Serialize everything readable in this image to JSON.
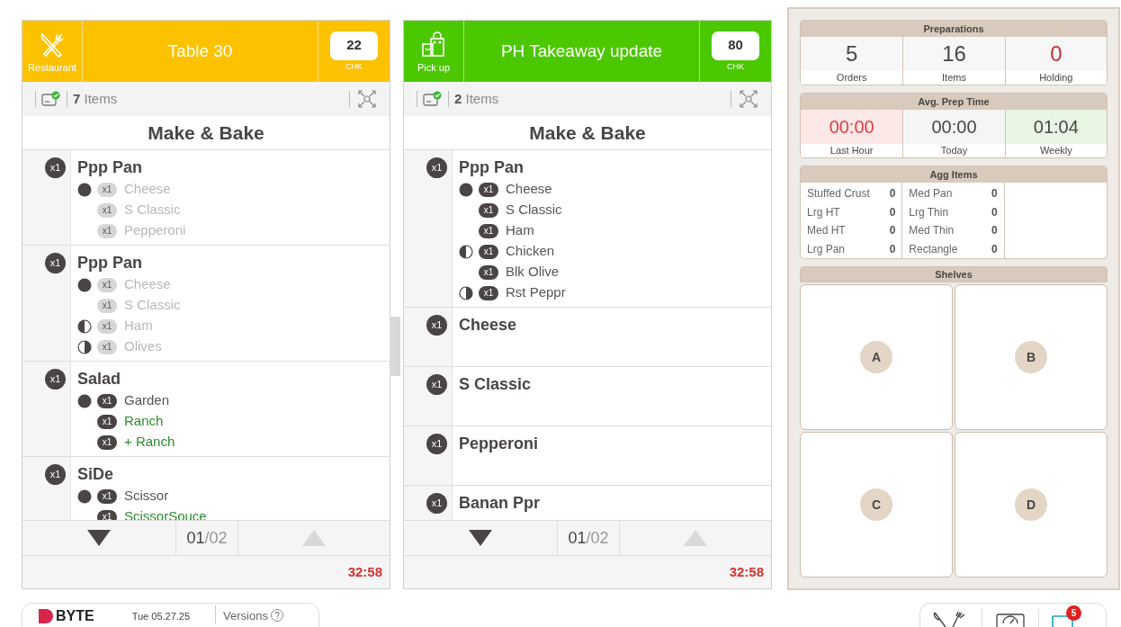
{
  "orders": [
    {
      "kind": "restaurant",
      "type_label": "Restaurant",
      "color": "#fcc200",
      "title": "Table 30",
      "check": "22",
      "check_label": "CHK",
      "item_count": "7",
      "item_label": "Items",
      "station": "Make & Bake",
      "items": [
        {
          "qty": "x1",
          "name": "Ppp Pan",
          "done": true,
          "modifiers": [
            {
              "kind": "whole",
              "qty": "x1",
              "name": "Cheese",
              "extra": false
            },
            {
              "kind": "plain",
              "qty": "x1",
              "name": "S Classic",
              "extra": false
            },
            {
              "kind": "plain",
              "qty": "x1",
              "name": "Pepperoni",
              "extra": false
            }
          ]
        },
        {
          "qty": "x1",
          "name": "Ppp Pan",
          "done": true,
          "modifiers": [
            {
              "kind": "whole",
              "qty": "x1",
              "name": "Cheese",
              "extra": false
            },
            {
              "kind": "plain",
              "qty": "x1",
              "name": "S Classic",
              "extra": false
            },
            {
              "kind": "left_half",
              "qty": "x1",
              "name": "Ham",
              "extra": false
            },
            {
              "kind": "right_half",
              "qty": "x1",
              "name": "Olives",
              "extra": false
            }
          ]
        },
        {
          "qty": "x1",
          "name": "Salad",
          "done": false,
          "modifiers": [
            {
              "kind": "whole",
              "qty": "x1",
              "name": "Garden",
              "extra": false
            },
            {
              "kind": "plain",
              "qty": "x1",
              "name": "Ranch",
              "extra": true
            },
            {
              "kind": "plain",
              "qty": "x1",
              "name": "+ Ranch",
              "extra": true
            }
          ]
        },
        {
          "qty": "x1",
          "name": "SiDe",
          "done": false,
          "modifiers": [
            {
              "kind": "whole",
              "qty": "x1",
              "name": "Scissor",
              "extra": false
            },
            {
              "kind": "plain",
              "qty": "x1",
              "name": "ScissorSouce",
              "extra": true
            }
          ]
        }
      ],
      "page_current": "01",
      "page_separator": "/",
      "page_total": "02",
      "can_page_down": true,
      "can_page_up": false,
      "timer": "32:58"
    },
    {
      "kind": "pickup",
      "type_label": "Pick up",
      "color": "#4cc800",
      "title": "PH Takeaway update",
      "check": "80",
      "check_label": "CHK",
      "item_count": "2",
      "item_label": "Items",
      "station": "Make & Bake",
      "items": [
        {
          "qty": "x1",
          "name": "Ppp Pan",
          "done": false,
          "modifiers": [
            {
              "kind": "whole",
              "qty": "x1",
              "name": "Cheese",
              "extra": false
            },
            {
              "kind": "plain",
              "qty": "x1",
              "name": "S Classic",
              "extra": false
            },
            {
              "kind": "plain",
              "qty": "x1",
              "name": "Ham",
              "extra": false
            },
            {
              "kind": "left_half",
              "qty": "x1",
              "name": "Chicken",
              "extra": false
            },
            {
              "kind": "plain",
              "qty": "x1",
              "name": "Blk Olive",
              "extra": false
            },
            {
              "kind": "right_half",
              "qty": "x1",
              "name": "Rst Peppr",
              "extra": false
            }
          ]
        },
        {
          "qty": "x1",
          "name": "Cheese"
        },
        {
          "qty": "x1",
          "name": "S Classic"
        },
        {
          "qty": "x1",
          "name": "Pepperoni"
        },
        {
          "qty": "x1",
          "name": "Banan Ppr"
        }
      ],
      "page_current": "01",
      "page_separator": "/",
      "page_total": "02",
      "can_page_down": true,
      "can_page_up": false,
      "timer": "32:58"
    }
  ],
  "preparations": {
    "title": "Preparations",
    "stats": [
      {
        "value": "5",
        "label": "Orders",
        "kind": "normal"
      },
      {
        "value": "16",
        "label": "Items",
        "kind": "normal"
      },
      {
        "value": "0",
        "label": "Holding",
        "kind": "alert"
      }
    ]
  },
  "avg_prep_time": {
    "title": "Avg. Prep Time",
    "stats": [
      {
        "value": "00:00",
        "label": "Last Hour",
        "kind": "bad"
      },
      {
        "value": "00:00",
        "label": "Today",
        "kind": "neutral"
      },
      {
        "value": "01:04",
        "label": "Weekly",
        "kind": "good"
      }
    ]
  },
  "agg_items": {
    "title": "Agg Items",
    "columns": [
      [
        {
          "name": "Stuffed Crust",
          "count": "0"
        },
        {
          "name": "Lrg HT",
          "count": "0"
        },
        {
          "name": "Med HT",
          "count": "0"
        },
        {
          "name": "Lrg Pan",
          "count": "0"
        }
      ],
      [
        {
          "name": "Med Pan",
          "count": "0"
        },
        {
          "name": "Lrg Thin",
          "count": "0"
        },
        {
          "name": "Med Thin",
          "count": "0"
        },
        {
          "name": "Rectangle",
          "count": "0"
        }
      ]
    ]
  },
  "shelves": {
    "title": "Shelves",
    "slots": [
      "A",
      "B",
      "C",
      "D"
    ]
  },
  "footer": {
    "brand": "BYTE",
    "date": "Tue 05.27.25",
    "versions": "Versions",
    "help": "?",
    "notification_count": "5"
  }
}
